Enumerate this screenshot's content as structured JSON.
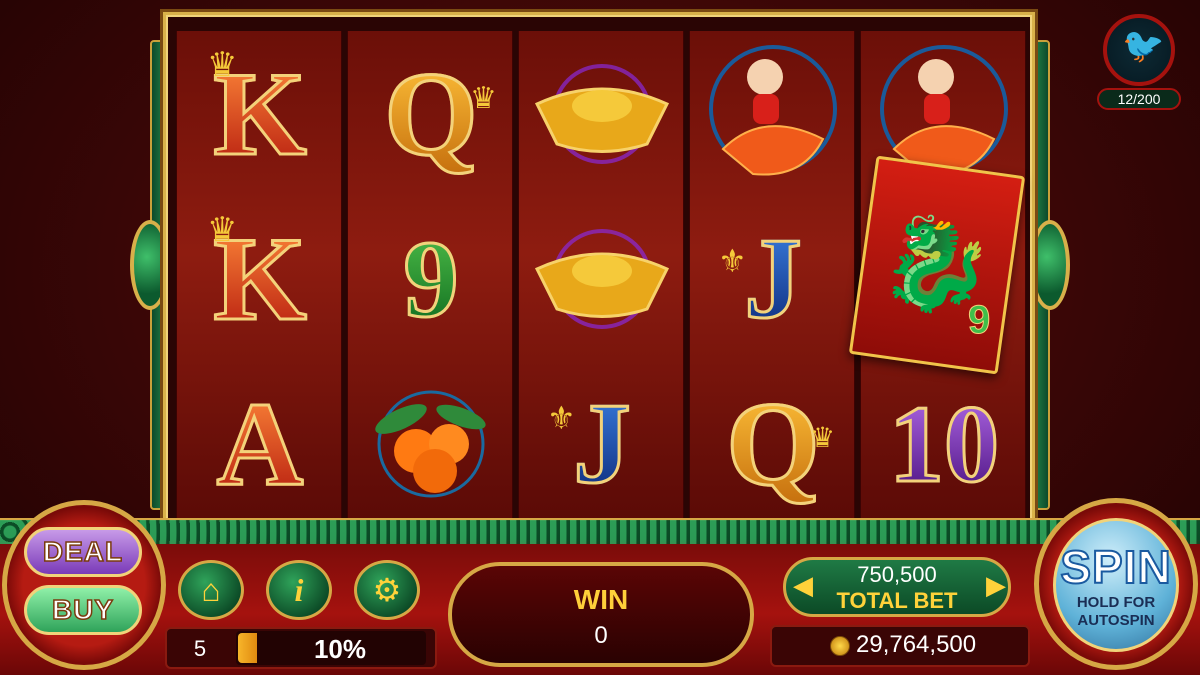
{
  "reels": [
    [
      "K",
      "K",
      "A"
    ],
    [
      "Q",
      "9",
      "orange-icon"
    ],
    [
      "gold-ingot-icon",
      "gold-ingot-icon",
      "J"
    ],
    [
      "boy-on-koi-icon",
      "J",
      "Q"
    ],
    [
      "boy-on-koi-icon",
      "9",
      "10"
    ]
  ],
  "overlay": {
    "card_symbol": "dragon-envelope-icon",
    "card_label": "9"
  },
  "controls": {
    "deal_label": "DEAL",
    "buy_label": "BUY",
    "home_icon": "home-icon",
    "info_icon": "info-icon",
    "settings_icon": "gear-icon",
    "level": "5",
    "level_progress_fraction": 0.1,
    "level_pct": "10%",
    "win_label": "WIN",
    "win_value": "0",
    "bet_value": "750,500",
    "bet_label": "TOTAL BET",
    "coins": "29,764,500",
    "spin_label": "SPIN",
    "spin_sub": "HOLD FOR AUTOSPIN"
  },
  "collection": {
    "icon": "hummingbird-icon",
    "label": "12/200"
  },
  "colors": {
    "accent_gold": "#d6a845",
    "panel_red": "#a5120e",
    "jade": "#1f7a45"
  }
}
